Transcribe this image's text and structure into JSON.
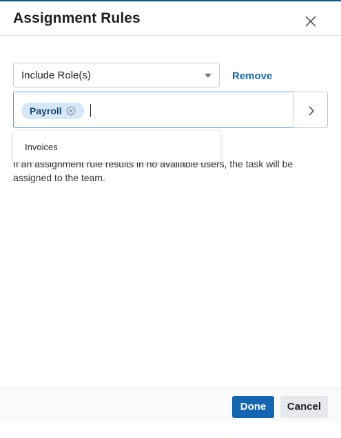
{
  "dialog": {
    "title": "Assignment Rules"
  },
  "rule": {
    "type_selected": "Include Role(s)",
    "remove_label": "Remove",
    "tags": [
      {
        "label": "Payroll"
      }
    ]
  },
  "dropdown": {
    "options": [
      {
        "label": "Invoices"
      }
    ]
  },
  "info_text": "If an assignment rule results in no available users, the task will be assigned to the team.",
  "footer": {
    "done_label": "Done",
    "cancel_label": "Cancel"
  },
  "colors": {
    "accent": "#1466b3",
    "chip_bg": "#d6e8f7",
    "link": "#1468b0"
  },
  "icons": {
    "close": "close-icon",
    "caret": "chevron-down-icon",
    "chip_remove": "circle-x-icon",
    "next": "chevron-right-icon"
  }
}
